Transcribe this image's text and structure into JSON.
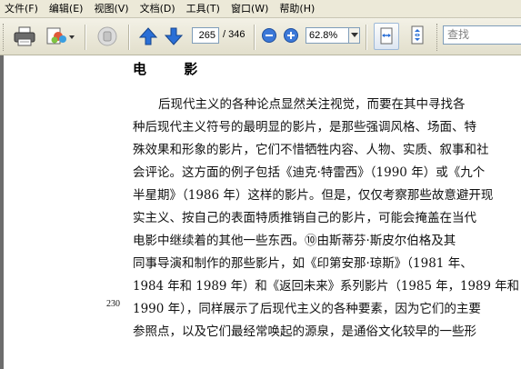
{
  "menu": [
    "文件(F)",
    "编辑(E)",
    "视图(V)",
    "文档(D)",
    "工具(T)",
    "窗口(W)",
    "帮助(H)"
  ],
  "toolbar": {
    "current_page": "265",
    "page_total": "/ 346",
    "zoom": "62.8%",
    "search_placeholder": "查找"
  },
  "document": {
    "heading": "电 影",
    "page_number": "230",
    "lines": [
      "后现代主义的各种论点显然关注视觉，而要在其中寻找各",
      "种后现代主义符号的最明显的影片，是那些强调风格、场面、特",
      "殊效果和形象的影片，它们不惜牺牲内容、人物、实质、叙事和社",
      "会评论。这方面的例子包括《迪克·特雷西》（1990 年）或《九个",
      "半星期》（1986 年）这样的影片。但是，仅仅考察那些故意避开现",
      "实主义、按自己的表面特质推销自己的影片，可能会掩盖在当代",
      "电影中继续着的其他一些东西。⑩由斯蒂芬·斯皮尔伯格及其",
      "同事导演和制作的那些影片，如《印第安那·琼斯》（1981 年、",
      "1984 年和 1989 年）和《返回未来》系列影片（1985 年，1989 年和",
      "1990 年），同样展示了后现代主义的各种要素，因为它们的主要",
      "参照点，以及它们最经常唤起的源泉，是通俗文化较早的一些形"
    ]
  },
  "colors": {
    "chrome": "#ece9d8",
    "arrow_blue": "#2a6fd6",
    "zoom_blue": "#3b78d8"
  }
}
